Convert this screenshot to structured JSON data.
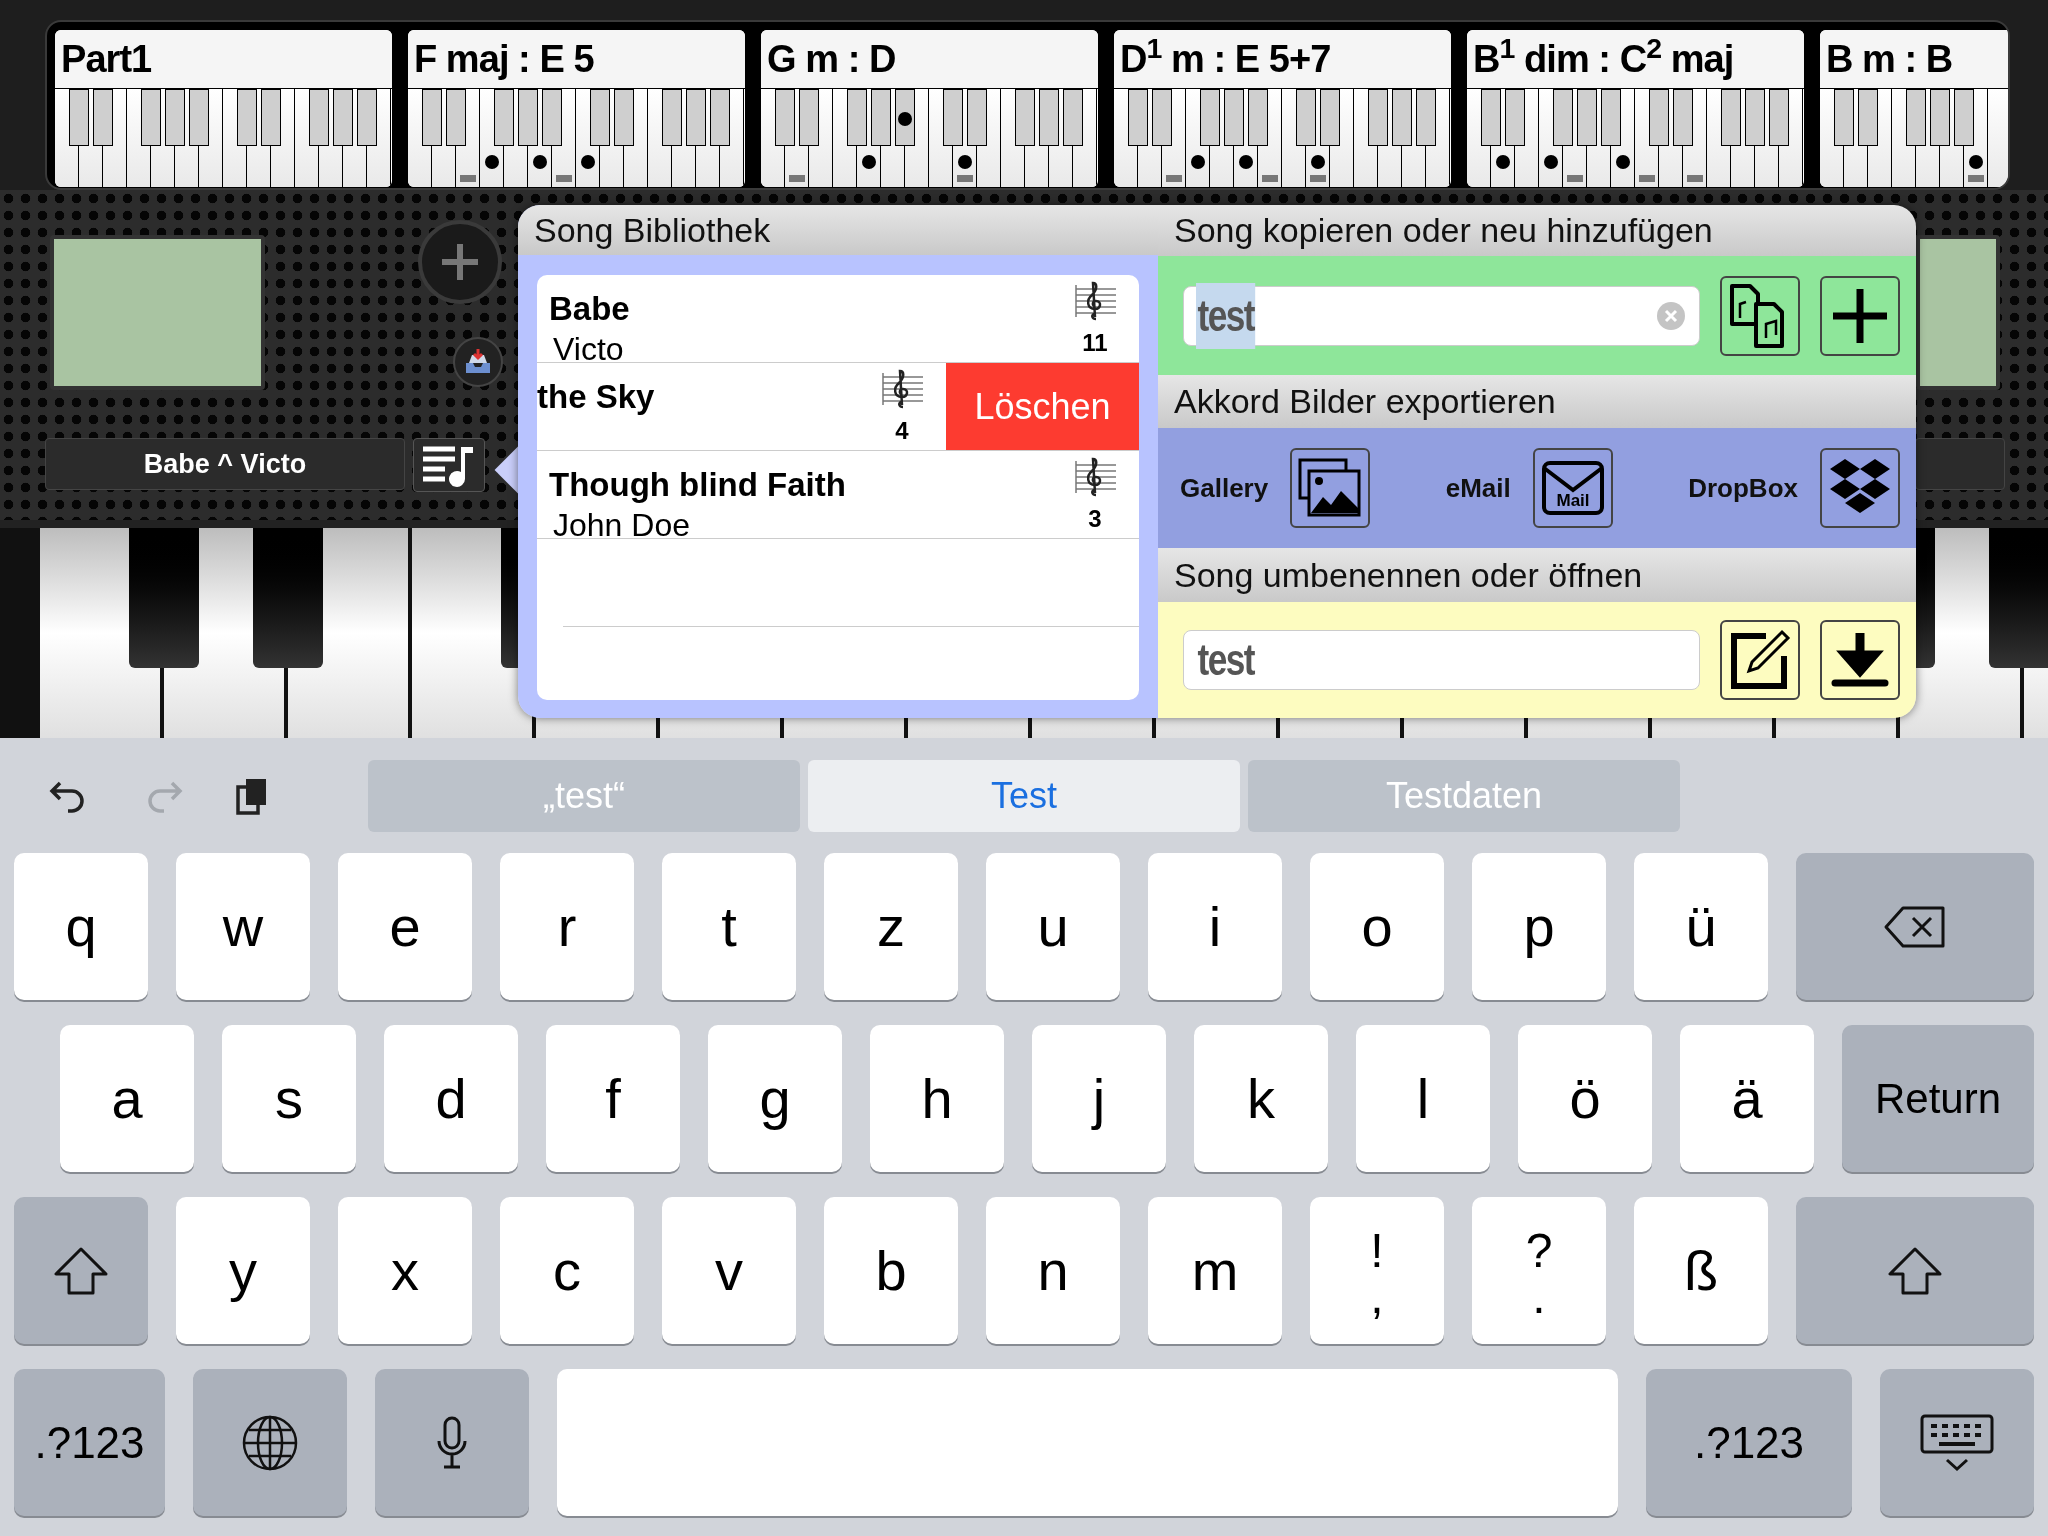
{
  "chords": [
    {
      "label": "Part1",
      "white_dots": [
        false,
        false,
        false,
        false,
        false,
        false,
        false,
        false,
        false,
        false,
        false,
        false,
        false,
        false
      ],
      "white_bars": [
        false,
        false,
        false,
        false,
        false,
        false,
        false,
        false,
        false,
        false,
        false,
        false,
        false,
        false
      ],
      "black_dots": [
        false,
        false,
        false,
        false,
        false,
        false,
        false,
        false,
        false,
        false
      ]
    },
    {
      "label": "F maj : E 5",
      "white_dots": [
        false,
        false,
        false,
        true,
        false,
        true,
        false,
        true,
        false,
        false,
        false,
        false,
        false,
        false
      ],
      "white_bars": [
        false,
        false,
        true,
        false,
        false,
        false,
        true,
        false,
        false,
        false,
        false,
        false,
        false,
        false
      ],
      "black_dots": [
        false,
        false,
        false,
        false,
        false,
        false,
        false,
        false,
        false,
        false
      ]
    },
    {
      "label": "G m : D",
      "white_dots": [
        false,
        false,
        false,
        false,
        true,
        false,
        false,
        false,
        true,
        false,
        false,
        false,
        false,
        false
      ],
      "white_bars": [
        false,
        true,
        false,
        false,
        false,
        false,
        false,
        false,
        true,
        false,
        false,
        false,
        false,
        false
      ],
      "black_dots": [
        false,
        false,
        false,
        false,
        true,
        false,
        false,
        false,
        false,
        false
      ]
    },
    {
      "label": "D$^{1}$ m : E 5+7",
      "white_dots": [
        false,
        false,
        false,
        true,
        false,
        true,
        false,
        false,
        true,
        false,
        false,
        false,
        false,
        false
      ],
      "white_bars": [
        false,
        false,
        true,
        false,
        false,
        false,
        true,
        false,
        true,
        false,
        false,
        false,
        false,
        false
      ],
      "black_dots": [
        false,
        false,
        false,
        false,
        false,
        false,
        false,
        false,
        false,
        false
      ]
    },
    {
      "label": "B$^{1}$ dim : C$^{2}$ maj",
      "white_dots": [
        false,
        true,
        false,
        true,
        false,
        false,
        true,
        false,
        false,
        false,
        false,
        false,
        false,
        false
      ],
      "white_bars": [
        false,
        false,
        false,
        false,
        true,
        false,
        false,
        true,
        false,
        true,
        false,
        false,
        false,
        false
      ],
      "black_dots": [
        false,
        false,
        false,
        false,
        false,
        false,
        false,
        false,
        false,
        false
      ]
    },
    {
      "label": "B m : B",
      "white_dots": [
        false,
        false,
        false,
        false,
        false,
        false,
        true,
        false
      ],
      "white_bars": [
        false,
        false,
        false,
        false,
        false,
        false,
        true,
        false
      ],
      "black_dots": [
        false,
        false,
        false,
        false,
        false
      ]
    }
  ],
  "current_song": "Babe ^ Victo",
  "library": {
    "title": "Song Bibliothek",
    "songs": [
      {
        "title": "Babe",
        "artist": "Victo",
        "count": "11",
        "swiped": false
      },
      {
        "title": "the Sky",
        "count": "4",
        "swiped": true,
        "delete_label": "Löschen"
      },
      {
        "title": "Though blind Faith",
        "artist": "John Doe",
        "count": "3",
        "swiped": false
      }
    ]
  },
  "copy_section": {
    "title": "Song kopieren oder neu hinzufügen",
    "field": {
      "value": "test",
      "selected": true
    }
  },
  "export_section": {
    "title": "Akkord Bilder exportieren",
    "items": [
      {
        "kind": "gallery",
        "label": "Gallery"
      },
      {
        "kind": "mail",
        "label": "eMail",
        "icon_text": "Mail"
      },
      {
        "kind": "dropbox",
        "label": "DropBox"
      }
    ]
  },
  "rename_section": {
    "title": "Song umbenennen oder öffnen",
    "field": {
      "value": "test",
      "selected": false
    }
  },
  "keyboard": {
    "tools": [
      {
        "kind": "undo",
        "disabled": false
      },
      {
        "kind": "redo",
        "disabled": true
      },
      {
        "kind": "paste",
        "disabled": false
      }
    ],
    "suggestions": [
      {
        "text": "„test“",
        "selected": false
      },
      {
        "text": "Test",
        "selected": true
      },
      {
        "text": "Testdaten",
        "selected": false
      }
    ],
    "rows": [
      {
        "keys": [
          {
            "kind": "char",
            "label": "q"
          },
          {
            "kind": "char",
            "label": "w"
          },
          {
            "kind": "char",
            "label": "e"
          },
          {
            "kind": "char",
            "label": "r"
          },
          {
            "kind": "char",
            "label": "t"
          },
          {
            "kind": "char",
            "label": "z"
          },
          {
            "kind": "char",
            "label": "u"
          },
          {
            "kind": "char",
            "label": "i"
          },
          {
            "kind": "char",
            "label": "o"
          },
          {
            "kind": "char",
            "label": "p"
          },
          {
            "kind": "char",
            "label": "ü"
          },
          {
            "kind": "backspace"
          }
        ]
      },
      {
        "keys": [
          {
            "kind": "char",
            "label": "a"
          },
          {
            "kind": "char",
            "label": "s"
          },
          {
            "kind": "char",
            "label": "d"
          },
          {
            "kind": "char",
            "label": "f"
          },
          {
            "kind": "char",
            "label": "g"
          },
          {
            "kind": "char",
            "label": "h"
          },
          {
            "kind": "char",
            "label": "j"
          },
          {
            "kind": "char",
            "label": "k"
          },
          {
            "kind": "char",
            "label": "l"
          },
          {
            "kind": "char",
            "label": "ö"
          },
          {
            "kind": "char",
            "label": "ä"
          },
          {
            "kind": "return",
            "label": "Return"
          }
        ]
      },
      {
        "keys": [
          {
            "kind": "shift"
          },
          {
            "kind": "char",
            "label": "y"
          },
          {
            "kind": "char",
            "label": "x"
          },
          {
            "kind": "char",
            "label": "c"
          },
          {
            "kind": "char",
            "label": "v"
          },
          {
            "kind": "char",
            "label": "b"
          },
          {
            "kind": "char",
            "label": "n"
          },
          {
            "kind": "char",
            "label": "m"
          },
          {
            "kind": "char",
            "label": "!",
            "sub": ","
          },
          {
            "kind": "char",
            "label": "?",
            "sub": "."
          },
          {
            "kind": "char",
            "label": "ß"
          },
          {
            "kind": "shift"
          }
        ]
      },
      {
        "keys": [
          {
            "kind": "symbols",
            "label": ".?123"
          },
          {
            "kind": "globe"
          },
          {
            "kind": "mic"
          },
          {
            "kind": "space"
          },
          {
            "kind": "symbols",
            "label": ".?123"
          },
          {
            "kind": "hide"
          }
        ]
      }
    ]
  }
}
